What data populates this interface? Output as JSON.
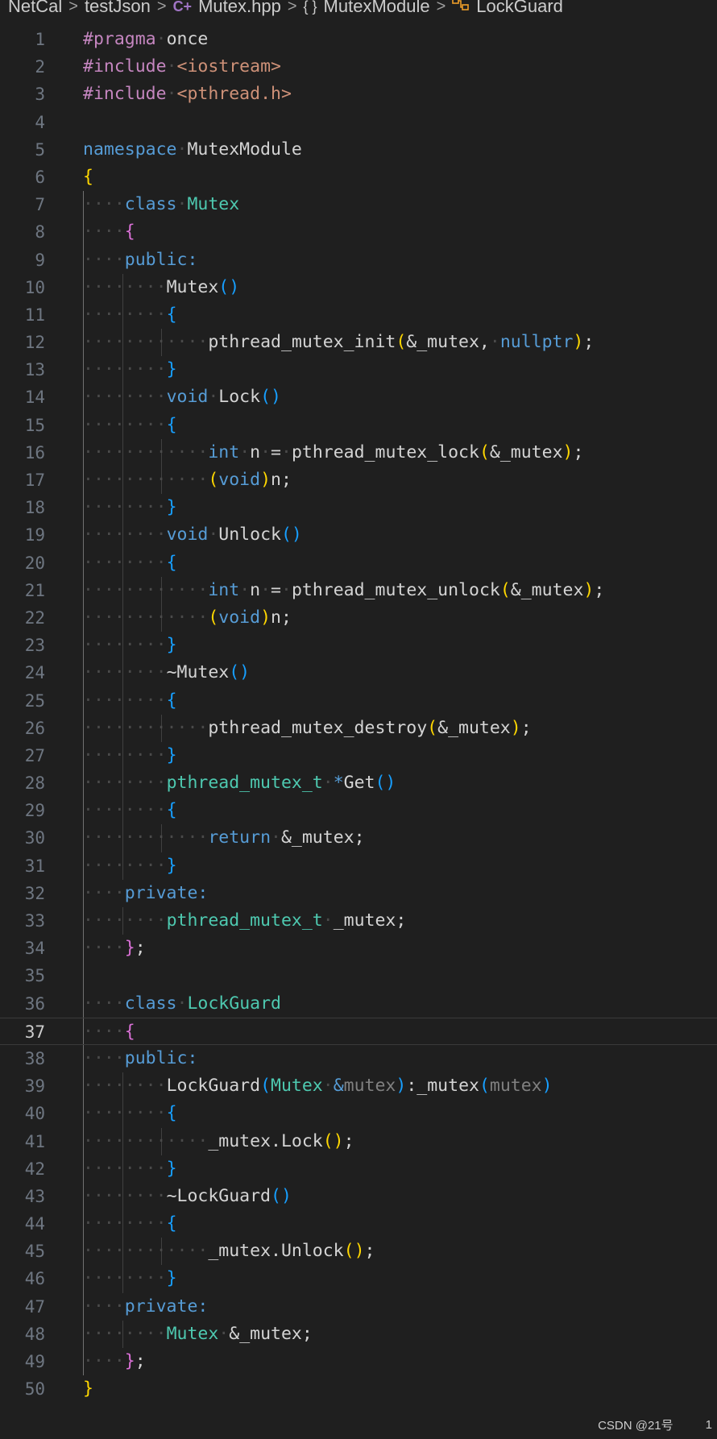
{
  "breadcrumb": {
    "items": [
      {
        "label": "NetCal",
        "icon": ""
      },
      {
        "label": "testJson",
        "icon": ""
      },
      {
        "label": "Mutex.hpp",
        "icon": "cpp-file-icon"
      },
      {
        "label": "MutexModule",
        "icon": "namespace-icon"
      },
      {
        "label": "LockGuard",
        "icon": "class-icon"
      }
    ],
    "separator": ">",
    "ns_glyph": "{ }",
    "cpp_glyph": "C+"
  },
  "editor": {
    "active_line": 37,
    "theme_colors": {
      "background": "#1f1f1f",
      "keyword": "#569cd6",
      "type": "#4ec9b0",
      "function": "#dcdcaa",
      "string": "#ce9178",
      "bracket_level_1": "#ffd700",
      "bracket_level_2": "#da70d6",
      "bracket_level_3": "#179fff"
    },
    "lines": [
      [
        [
          "pp",
          "#pragma"
        ],
        [
          "ws",
          "·"
        ],
        [
          "plain",
          "once"
        ]
      ],
      [
        [
          "pp",
          "#include"
        ],
        [
          "ws",
          "·"
        ],
        [
          "str",
          "<iostream>"
        ]
      ],
      [
        [
          "pp",
          "#include"
        ],
        [
          "ws",
          "·"
        ],
        [
          "str",
          "<pthread.h>"
        ]
      ],
      [],
      [
        [
          "kw",
          "namespace"
        ],
        [
          "ws",
          "·"
        ],
        [
          "plain",
          "MutexModule"
        ]
      ],
      [
        [
          "b1",
          "{"
        ]
      ],
      [
        [
          "ws",
          "····"
        ],
        [
          "kw",
          "class"
        ],
        [
          "ws",
          "·"
        ],
        [
          "ty",
          "Mutex"
        ]
      ],
      [
        [
          "ws",
          "····"
        ],
        [
          "b2",
          "{"
        ]
      ],
      [
        [
          "ws",
          "····"
        ],
        [
          "kw",
          "public:"
        ]
      ],
      [
        [
          "ws",
          "········"
        ],
        [
          "plain",
          "Mutex"
        ],
        [
          "b3",
          "()"
        ]
      ],
      [
        [
          "ws",
          "········"
        ],
        [
          "b3",
          "{"
        ]
      ],
      [
        [
          "ws",
          "············"
        ],
        [
          "plain",
          "pthread_mutex_init"
        ],
        [
          "b1",
          "("
        ],
        [
          "plain",
          "&_mutex,"
        ],
        [
          "ws",
          "·"
        ],
        [
          "kw",
          "nullptr"
        ],
        [
          "b1",
          ")"
        ],
        [
          "plain",
          ";"
        ]
      ],
      [
        [
          "ws",
          "········"
        ],
        [
          "b3",
          "}"
        ]
      ],
      [
        [
          "ws",
          "········"
        ],
        [
          "kw",
          "void"
        ],
        [
          "ws",
          "·"
        ],
        [
          "plain",
          "Lock"
        ],
        [
          "b3",
          "()"
        ]
      ],
      [
        [
          "ws",
          "········"
        ],
        [
          "b3",
          "{"
        ]
      ],
      [
        [
          "ws",
          "············"
        ],
        [
          "kw",
          "int"
        ],
        [
          "ws",
          "·"
        ],
        [
          "plain",
          "n"
        ],
        [
          "ws",
          "·"
        ],
        [
          "plain",
          "="
        ],
        [
          "ws",
          "·"
        ],
        [
          "plain",
          "pthread_mutex_lock"
        ],
        [
          "b1",
          "("
        ],
        [
          "plain",
          "&_mutex"
        ],
        [
          "b1",
          ")"
        ],
        [
          "plain",
          ";"
        ]
      ],
      [
        [
          "ws",
          "············"
        ],
        [
          "b1",
          "("
        ],
        [
          "kw",
          "void"
        ],
        [
          "b1",
          ")"
        ],
        [
          "plain",
          "n;"
        ]
      ],
      [
        [
          "ws",
          "········"
        ],
        [
          "b3",
          "}"
        ]
      ],
      [
        [
          "ws",
          "········"
        ],
        [
          "kw",
          "void"
        ],
        [
          "ws",
          "·"
        ],
        [
          "plain",
          "Unlock"
        ],
        [
          "b3",
          "()"
        ]
      ],
      [
        [
          "ws",
          "········"
        ],
        [
          "b3",
          "{"
        ]
      ],
      [
        [
          "ws",
          "············"
        ],
        [
          "kw",
          "int"
        ],
        [
          "ws",
          "·"
        ],
        [
          "plain",
          "n"
        ],
        [
          "ws",
          "·"
        ],
        [
          "plain",
          "="
        ],
        [
          "ws",
          "·"
        ],
        [
          "plain",
          "pthread_mutex_unlock"
        ],
        [
          "b1",
          "("
        ],
        [
          "plain",
          "&_mutex"
        ],
        [
          "b1",
          ")"
        ],
        [
          "plain",
          ";"
        ]
      ],
      [
        [
          "ws",
          "············"
        ],
        [
          "b1",
          "("
        ],
        [
          "kw",
          "void"
        ],
        [
          "b1",
          ")"
        ],
        [
          "plain",
          "n;"
        ]
      ],
      [
        [
          "ws",
          "········"
        ],
        [
          "b3",
          "}"
        ]
      ],
      [
        [
          "ws",
          "········"
        ],
        [
          "plain",
          "~Mutex"
        ],
        [
          "b3",
          "()"
        ]
      ],
      [
        [
          "ws",
          "········"
        ],
        [
          "b3",
          "{"
        ]
      ],
      [
        [
          "ws",
          "············"
        ],
        [
          "plain",
          "pthread_mutex_destroy"
        ],
        [
          "b1",
          "("
        ],
        [
          "plain",
          "&_mutex"
        ],
        [
          "b1",
          ")"
        ],
        [
          "plain",
          ";"
        ]
      ],
      [
        [
          "ws",
          "········"
        ],
        [
          "b3",
          "}"
        ]
      ],
      [
        [
          "ws",
          "········"
        ],
        [
          "ty",
          "pthread_mutex_t"
        ],
        [
          "ws",
          "·"
        ],
        [
          "kw",
          "*"
        ],
        [
          "plain",
          "Get"
        ],
        [
          "b3",
          "()"
        ]
      ],
      [
        [
          "ws",
          "········"
        ],
        [
          "b3",
          "{"
        ]
      ],
      [
        [
          "ws",
          "············"
        ],
        [
          "kw",
          "return"
        ],
        [
          "ws",
          "·"
        ],
        [
          "plain",
          "&_mutex;"
        ]
      ],
      [
        [
          "ws",
          "········"
        ],
        [
          "b3",
          "}"
        ]
      ],
      [
        [
          "ws",
          "····"
        ],
        [
          "kw",
          "private:"
        ]
      ],
      [
        [
          "ws",
          "········"
        ],
        [
          "ty",
          "pthread_mutex_t"
        ],
        [
          "ws",
          "·"
        ],
        [
          "plain",
          "_mutex;"
        ]
      ],
      [
        [
          "ws",
          "····"
        ],
        [
          "b2",
          "}"
        ],
        [
          "plain",
          ";"
        ]
      ],
      [],
      [
        [
          "ws",
          "····"
        ],
        [
          "kw",
          "class"
        ],
        [
          "ws",
          "·"
        ],
        [
          "ty",
          "LockGuard"
        ]
      ],
      [
        [
          "ws",
          "····"
        ],
        [
          "b2",
          "{"
        ]
      ],
      [
        [
          "ws",
          "····"
        ],
        [
          "kw",
          "public:"
        ]
      ],
      [
        [
          "ws",
          "········"
        ],
        [
          "plain",
          "LockGuard"
        ],
        [
          "b3",
          "("
        ],
        [
          "ty",
          "Mutex"
        ],
        [
          "ws",
          "·"
        ],
        [
          "kw",
          "&"
        ],
        [
          "param",
          "mutex"
        ],
        [
          "b3",
          ")"
        ],
        [
          "plain",
          ":_mutex"
        ],
        [
          "b3",
          "("
        ],
        [
          "param",
          "mutex"
        ],
        [
          "b3",
          ")"
        ]
      ],
      [
        [
          "ws",
          "········"
        ],
        [
          "b3",
          "{"
        ]
      ],
      [
        [
          "ws",
          "············"
        ],
        [
          "plain",
          "_mutex.Lock"
        ],
        [
          "b1",
          "()"
        ],
        [
          "plain",
          ";"
        ]
      ],
      [
        [
          "ws",
          "········"
        ],
        [
          "b3",
          "}"
        ]
      ],
      [
        [
          "ws",
          "········"
        ],
        [
          "plain",
          "~LockGuard"
        ],
        [
          "b3",
          "()"
        ]
      ],
      [
        [
          "ws",
          "········"
        ],
        [
          "b3",
          "{"
        ]
      ],
      [
        [
          "ws",
          "············"
        ],
        [
          "plain",
          "_mutex.Unlock"
        ],
        [
          "b1",
          "()"
        ],
        [
          "plain",
          ";"
        ]
      ],
      [
        [
          "ws",
          "········"
        ],
        [
          "b3",
          "}"
        ]
      ],
      [
        [
          "ws",
          "····"
        ],
        [
          "kw",
          "private:"
        ]
      ],
      [
        [
          "ws",
          "········"
        ],
        [
          "ty",
          "Mutex"
        ],
        [
          "ws",
          "·"
        ],
        [
          "plain",
          "&_mutex;"
        ]
      ],
      [
        [
          "ws",
          "····"
        ],
        [
          "b2",
          "}"
        ],
        [
          "plain",
          ";"
        ]
      ],
      [
        [
          "b1",
          "}"
        ]
      ]
    ]
  },
  "status": {
    "watermark": "CSDN @21号",
    "number": "1"
  }
}
